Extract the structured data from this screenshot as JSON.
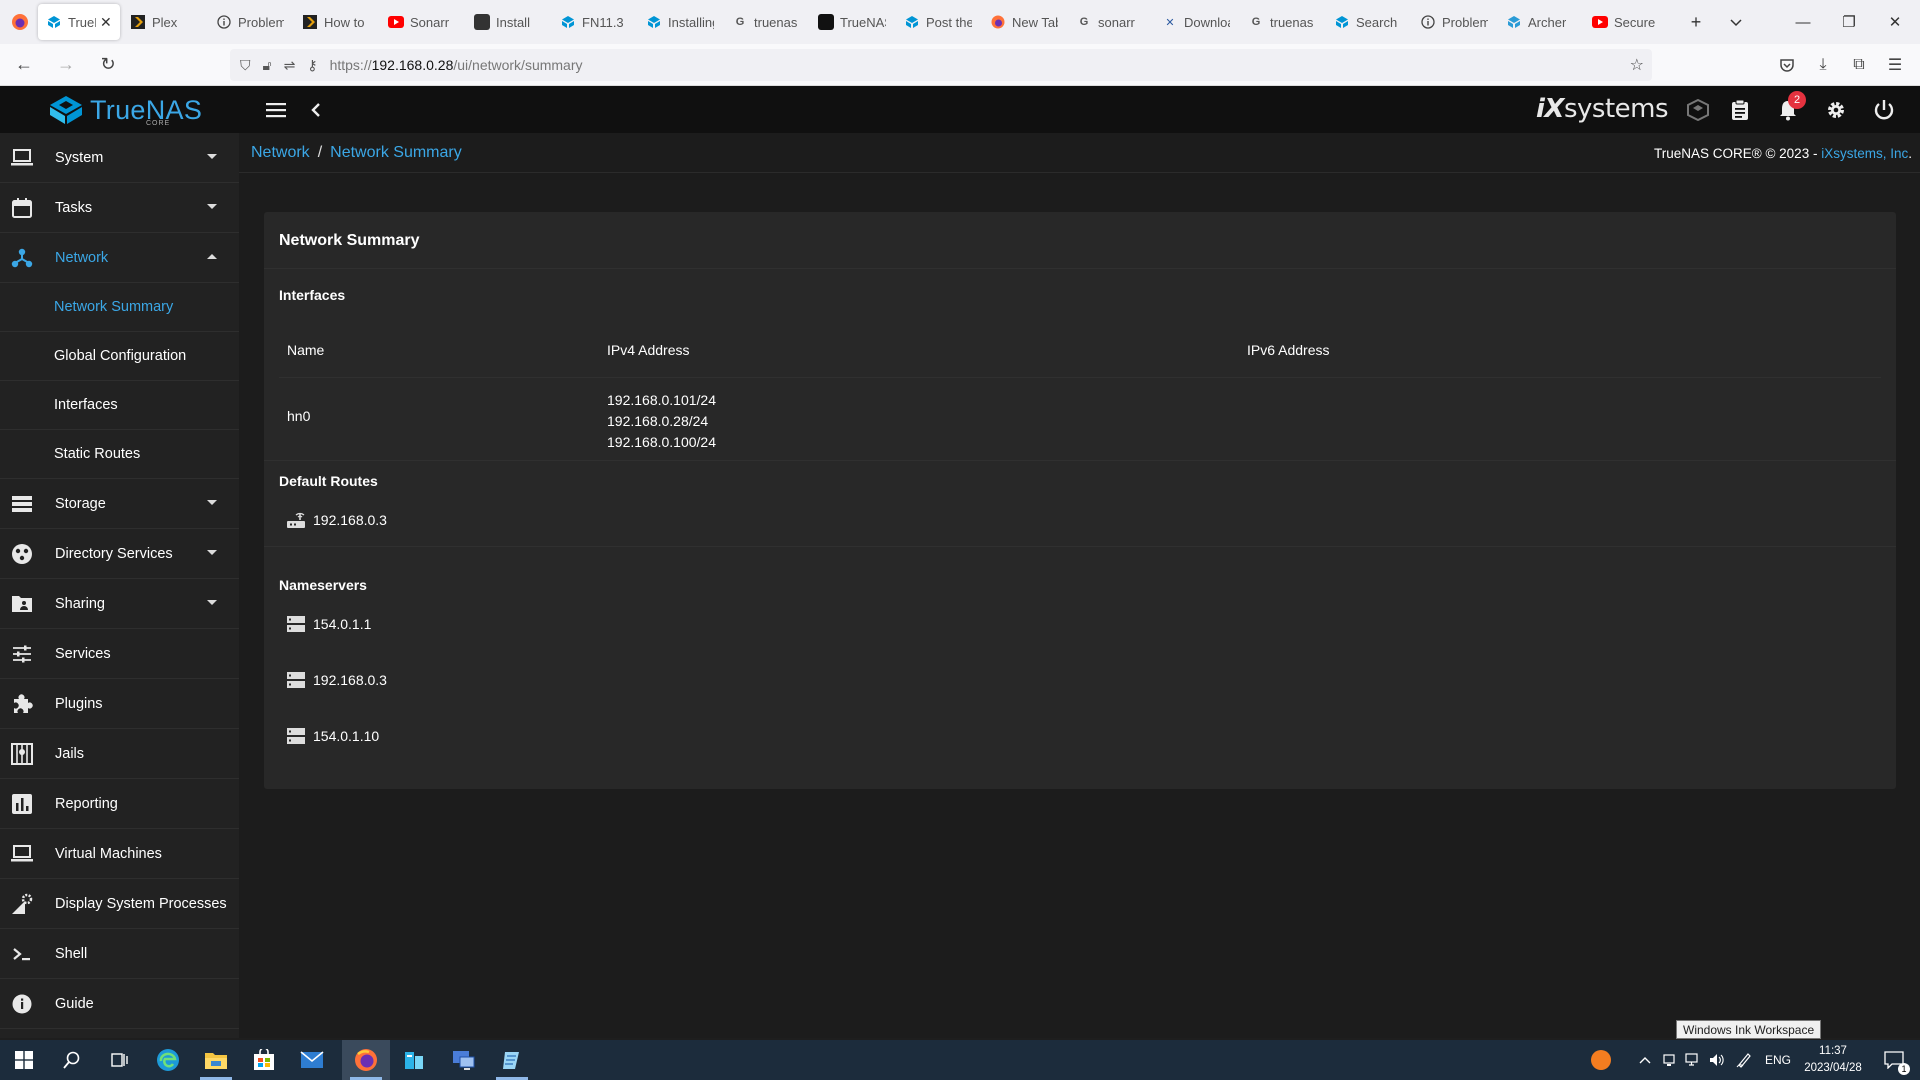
{
  "browser": {
    "tabs": [
      {
        "label": "TrueNAS",
        "favicon": "truenas",
        "color": "#0095d5",
        "active": true
      },
      {
        "label": "Plex",
        "favicon": "plex",
        "color": "#e5a00d"
      },
      {
        "label": "Problem",
        "favicon": "info",
        "color": "#444444"
      },
      {
        "label": "How to",
        "favicon": "plex",
        "color": "#e5a00d"
      },
      {
        "label": "Sonarr",
        "favicon": "youtube",
        "color": "#ff0000"
      },
      {
        "label": "Install",
        "favicon": "dark",
        "color": "#333333"
      },
      {
        "label": "FN11.3",
        "favicon": "truenas",
        "color": "#0095d5"
      },
      {
        "label": "Installing",
        "favicon": "truenas",
        "color": "#0095d5"
      },
      {
        "label": "truenas",
        "favicon": "google",
        "color": "#4285f4"
      },
      {
        "label": "TrueNAS",
        "favicon": "dark",
        "color": "#111111"
      },
      {
        "label": "Post the",
        "favicon": "truenas",
        "color": "#0095d5"
      },
      {
        "label": "New Tab",
        "favicon": "firefox",
        "color": "#ff7139"
      },
      {
        "label": "sonarr",
        "favicon": "google",
        "color": "#4285f4"
      },
      {
        "label": "Download",
        "favicon": "x",
        "color": "#2c5aa0"
      },
      {
        "label": "truenas",
        "favicon": "google",
        "color": "#4285f4"
      },
      {
        "label": "Search",
        "favicon": "truenas",
        "color": "#0095d5"
      },
      {
        "label": "Problem",
        "favicon": "info",
        "color": "#444444"
      },
      {
        "label": "Archer",
        "favicon": "archer",
        "color": "#2a9bd6"
      },
      {
        "label": "Secure",
        "favicon": "youtube",
        "color": "#ff0000"
      }
    ],
    "url": {
      "prefix": "https://",
      "host": "192.168.0.28",
      "path": "/ui/network/summary"
    }
  },
  "header": {
    "logo_text": "TrueNAS",
    "logo_sub": "CORE",
    "brand_ix": "iX",
    "brand_rest": "systems",
    "notification_count": "2"
  },
  "sidebar": {
    "items": [
      {
        "label": "System",
        "icon": "laptop-icon",
        "caret": "down"
      },
      {
        "label": "Tasks",
        "icon": "calendar-icon",
        "caret": "down"
      },
      {
        "label": "Network",
        "icon": "network-icon",
        "caret": "up",
        "active": true
      },
      {
        "label": "Storage",
        "icon": "storage-icon",
        "caret": "down"
      },
      {
        "label": "Directory Services",
        "icon": "directory-icon",
        "caret": "down"
      },
      {
        "label": "Sharing",
        "icon": "folder-share-icon",
        "caret": "down"
      },
      {
        "label": "Services",
        "icon": "tune-icon"
      },
      {
        "label": "Plugins",
        "icon": "puzzle-icon"
      },
      {
        "label": "Jails",
        "icon": "jail-icon"
      },
      {
        "label": "Reporting",
        "icon": "chart-icon"
      },
      {
        "label": "Virtual Machines",
        "icon": "laptop-icon"
      },
      {
        "label": "Display System Processes",
        "icon": "processes-icon"
      },
      {
        "label": "Shell",
        "icon": "shell-icon"
      },
      {
        "label": "Guide",
        "icon": "info-icon"
      }
    ],
    "network_sub": [
      {
        "label": "Network Summary",
        "active": true
      },
      {
        "label": "Global Configuration"
      },
      {
        "label": "Interfaces"
      },
      {
        "label": "Static Routes"
      }
    ]
  },
  "breadcrumb": {
    "parent": "Network",
    "separator": "/",
    "current": "Network Summary"
  },
  "copyright": {
    "text": "TrueNAS CORE® © 2023 - ",
    "link": "iXsystems, Inc",
    "suffix": "."
  },
  "card": {
    "title": "Network Summary",
    "interfaces_title": "Interfaces",
    "columns": [
      "Name",
      "IPv4 Address",
      "IPv6 Address"
    ],
    "rows": [
      {
        "name": "hn0",
        "ipv4": [
          "192.168.0.101/24",
          "192.168.0.28/24",
          "192.168.0.100/24"
        ],
        "ipv6": ""
      }
    ],
    "default_routes_title": "Default Routes",
    "default_routes": [
      "192.168.0.3"
    ],
    "nameservers_title": "Nameservers",
    "nameservers": [
      "154.0.1.1",
      "192.168.0.3",
      "154.0.1.10"
    ]
  },
  "ink_tooltip": "Windows Ink Workspace",
  "taskbar": {
    "lang": "ENG",
    "time": "11:37",
    "date": "2023/04/28",
    "notifications": "1"
  },
  "colors": {
    "accent": "#3ba7e6",
    "header_bg": "#101010",
    "sidebar_bg": "#222222",
    "card_bg": "#282828",
    "badge": "#e5323f"
  }
}
